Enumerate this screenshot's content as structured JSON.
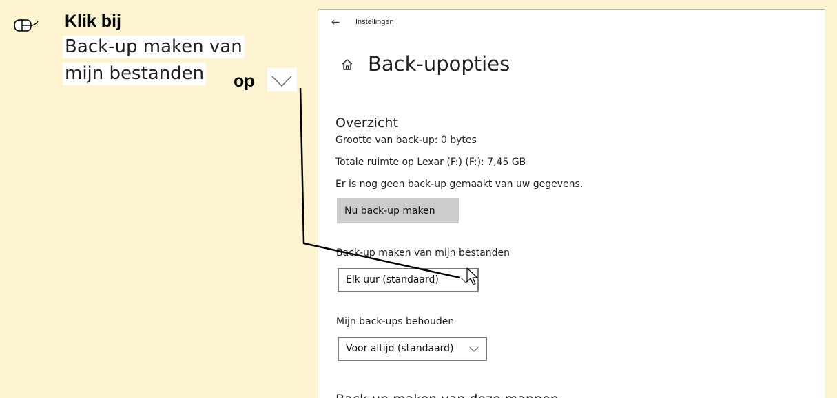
{
  "tutorial": {
    "instruction_bold": "Klik bij",
    "highlight_line1": "Back-up maken van",
    "highlight_line2": "mijn bestanden",
    "op_word": "op",
    "icons": [
      "mouse-icon",
      "chevron-down-icon"
    ]
  },
  "window": {
    "back_icon": "back-arrow-icon",
    "title": "Instellingen"
  },
  "page": {
    "home_icon": "home-icon",
    "title": "Back-upopties"
  },
  "overview": {
    "heading": "Overzicht",
    "backup_size": "Grootte van back-up: 0 bytes",
    "total_space": "Totale ruimte op Lexar (F:) (F:): 7,45 GB",
    "no_backup": "Er is nog geen back-up gemaakt van uw gegevens.",
    "backup_now_button": "Nu back-up maken"
  },
  "frequency": {
    "label": "Back-up maken van mijn bestanden",
    "selected": "Elk uur (standaard)"
  },
  "retention": {
    "label": "Mijn back-ups behouden",
    "selected": "Voor altijd (standaard)"
  },
  "folders": {
    "heading": "Back-up maken van deze mappen"
  },
  "colors": {
    "tutorial_background": "#fdf3d0",
    "button_gray": "#cccccc",
    "dropdown_border": "#7a7a7a"
  }
}
